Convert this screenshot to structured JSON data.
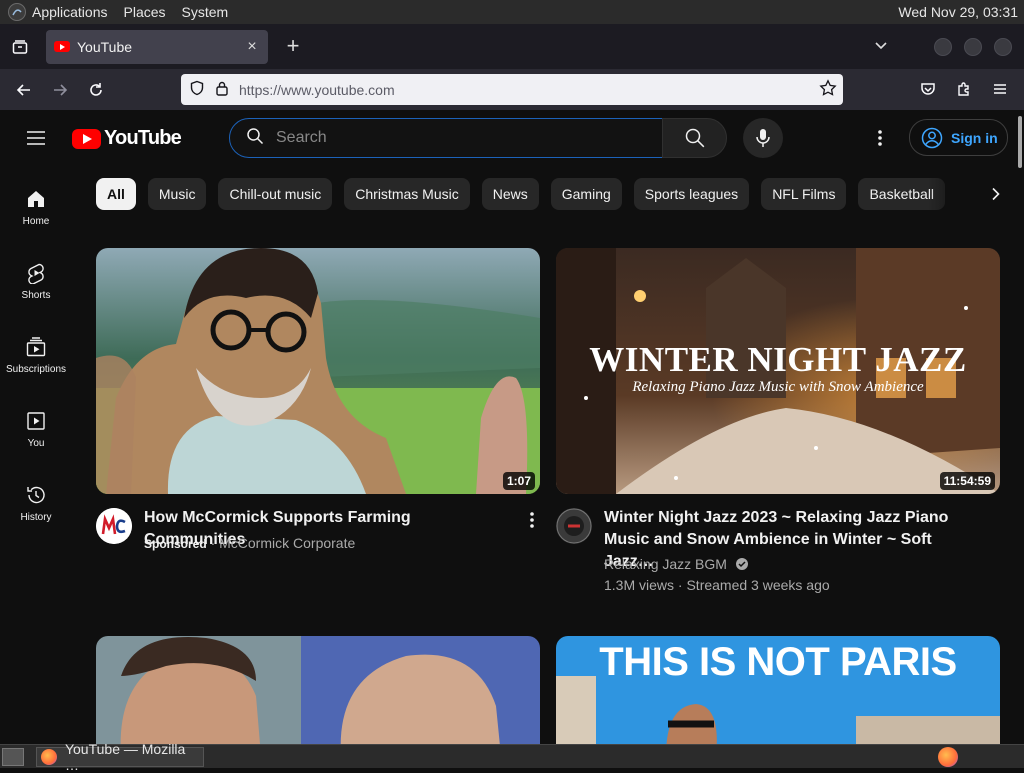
{
  "desktop": {
    "menus": [
      "Applications",
      "Places",
      "System"
    ],
    "clock": "Wed Nov 29, 03:31"
  },
  "browser": {
    "tab_title": "YouTube",
    "url_host": "https://www.youtube.com",
    "new_tab_label": "+",
    "close_tab_label": "×"
  },
  "youtube": {
    "logo_text": "YouTube",
    "search_placeholder": "Search",
    "sign_in": "Sign in",
    "guide": [
      {
        "label": "Home",
        "icon": "home-icon"
      },
      {
        "label": "Shorts",
        "icon": "shorts-icon"
      },
      {
        "label": "Subscriptions",
        "icon": "subscriptions-icon"
      },
      {
        "label": "You",
        "icon": "you-icon"
      },
      {
        "label": "History",
        "icon": "history-icon"
      }
    ],
    "chips": [
      "All",
      "Music",
      "Chill-out music",
      "Christmas Music",
      "News",
      "Gaming",
      "Sports leagues",
      "NFL Films",
      "Basketball"
    ],
    "videos": [
      {
        "title": "How McCormick Supports Farming Communities",
        "sponsored": "Sponsored",
        "channel": "McCormick Corporate",
        "duration": "1:07"
      },
      {
        "title_line1": "Winter Night Jazz 2023 ~ Relaxing Jazz Piano",
        "title_line2": "Music and Snow Ambience in Winter ~ Soft Jazz…",
        "channel": "Relaxing Jazz BGM",
        "meta": "1.3M views · Streamed 3 weeks ago",
        "duration": "11:54:59",
        "thumb_title": "WINTER NIGHT JAZZ",
        "thumb_subtitle": "Relaxing Piano Jazz Music with Snow Ambience"
      },
      {
        "duration": ""
      },
      {
        "thumb_title": "THIS IS NOT PARIS"
      }
    ]
  },
  "taskbar": {
    "task_label": "YouTube — Mozilla …"
  },
  "colors": {
    "yt_red": "#ff0000",
    "link_blue": "#3ea6ff",
    "search_focus": "#1c62b9"
  }
}
